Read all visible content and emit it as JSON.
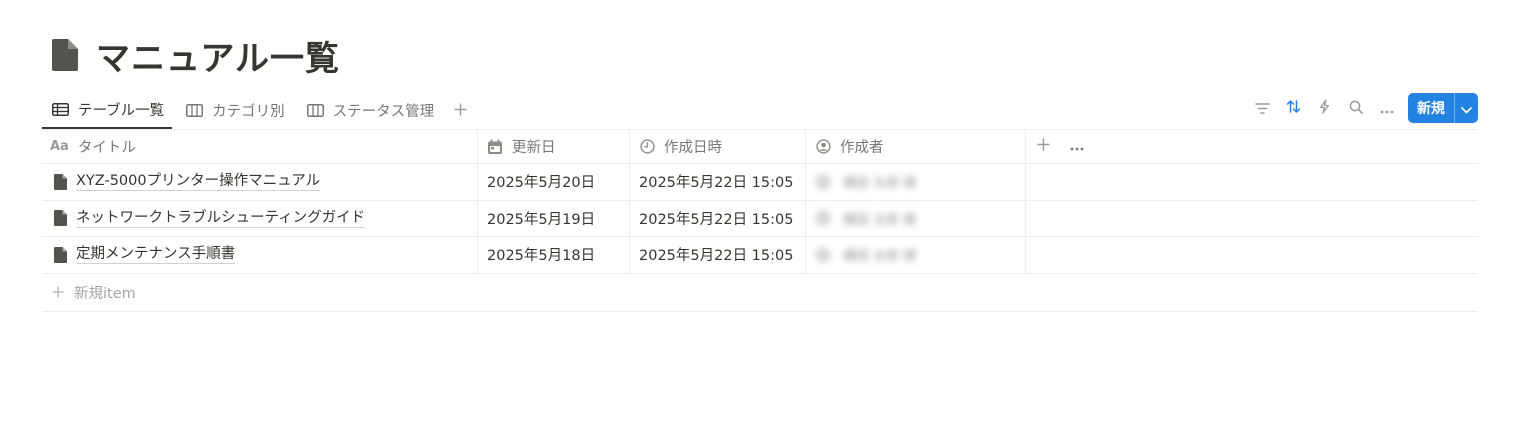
{
  "page": {
    "icon": "document-icon",
    "title": "マニュアル一覧"
  },
  "views": {
    "tabs": [
      {
        "label": "テーブル一覧",
        "icon": "table-icon",
        "active": true
      },
      {
        "label": "カテゴリ別",
        "icon": "board-icon",
        "active": false
      },
      {
        "label": "ステータス管理",
        "icon": "board-icon",
        "active": false
      }
    ],
    "add_icon": "plus-icon"
  },
  "toolbar": {
    "icons": [
      "filter-icon",
      "sort-icon",
      "automation-icon",
      "search-icon",
      "more-icon"
    ],
    "new_label": "新規",
    "accent": "#2383e2"
  },
  "table": {
    "columns": [
      {
        "label": "タイトル",
        "icon": "text-property-icon",
        "icon_text": "Aa"
      },
      {
        "label": "更新日",
        "icon": "calendar-icon"
      },
      {
        "label": "作成日時",
        "icon": "clock-icon"
      },
      {
        "label": "作成者",
        "icon": "person-icon"
      }
    ],
    "rows": [
      {
        "title": "XYZ-5000プリンター操作マニュアル",
        "updated": "2025年5月20日",
        "created": "2025年5月22日 15:05",
        "author": "横田 太郎 様"
      },
      {
        "title": "ネットワークトラブルシューティングガイド",
        "updated": "2025年5月19日",
        "created": "2025年5月22日 15:05",
        "author": "横田 太郎 様"
      },
      {
        "title": "定期メンテナンス手順書",
        "updated": "2025年5月18日",
        "created": "2025年5月22日 15:05",
        "author": "横田 太郎 様"
      }
    ],
    "new_item_label": "新規item"
  }
}
